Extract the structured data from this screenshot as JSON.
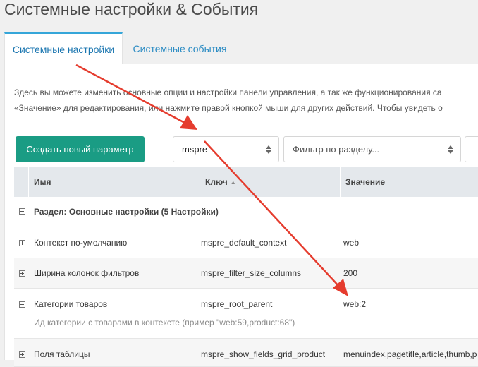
{
  "page": {
    "title": "Системные настройки & События"
  },
  "tabs": [
    {
      "label": "Системные настройки",
      "active": true
    },
    {
      "label": "Системные события",
      "active": false
    }
  ],
  "description": {
    "line1": "Здесь вы можете изменить основные опции и настройки панели управления, а так же функционирования са",
    "line2": "«Значение» для редактирования, или нажмите правой кнопкой мыши для других действий. Чтобы увидеть о"
  },
  "toolbar": {
    "create_label": "Создать новый параметр",
    "namespace_value": "mspre",
    "area_placeholder": "Фильтр по разделу..."
  },
  "grid": {
    "columns": {
      "name": "Имя",
      "key": "Ключ",
      "value": "Значение"
    },
    "sort_indicator": "▲",
    "group": {
      "label": "Раздел: Основные настройки (5 Настройки)"
    },
    "rows": [
      {
        "name": "Контекст по-умолчанию",
        "key": "mspre_default_context",
        "value": "web"
      },
      {
        "name": "Ширина колонок фильтров",
        "key": "mspre_filter_size_columns",
        "value": "200"
      },
      {
        "name": "Категории товаров",
        "key": "mspre_root_parent",
        "value": "web:2",
        "description": "Ид категории с товарами в контексте (пример \"web:59,product:68\")"
      },
      {
        "name": "Поля таблицы",
        "key": "mspre_show_fields_grid_product",
        "value": "menuindex,pagetitle,article,thumb,p"
      }
    ]
  },
  "colors": {
    "accent": "#1a9c84",
    "tab_border": "#35a6d9",
    "link": "#2a8bc3",
    "arrow": "#e53c2e"
  }
}
